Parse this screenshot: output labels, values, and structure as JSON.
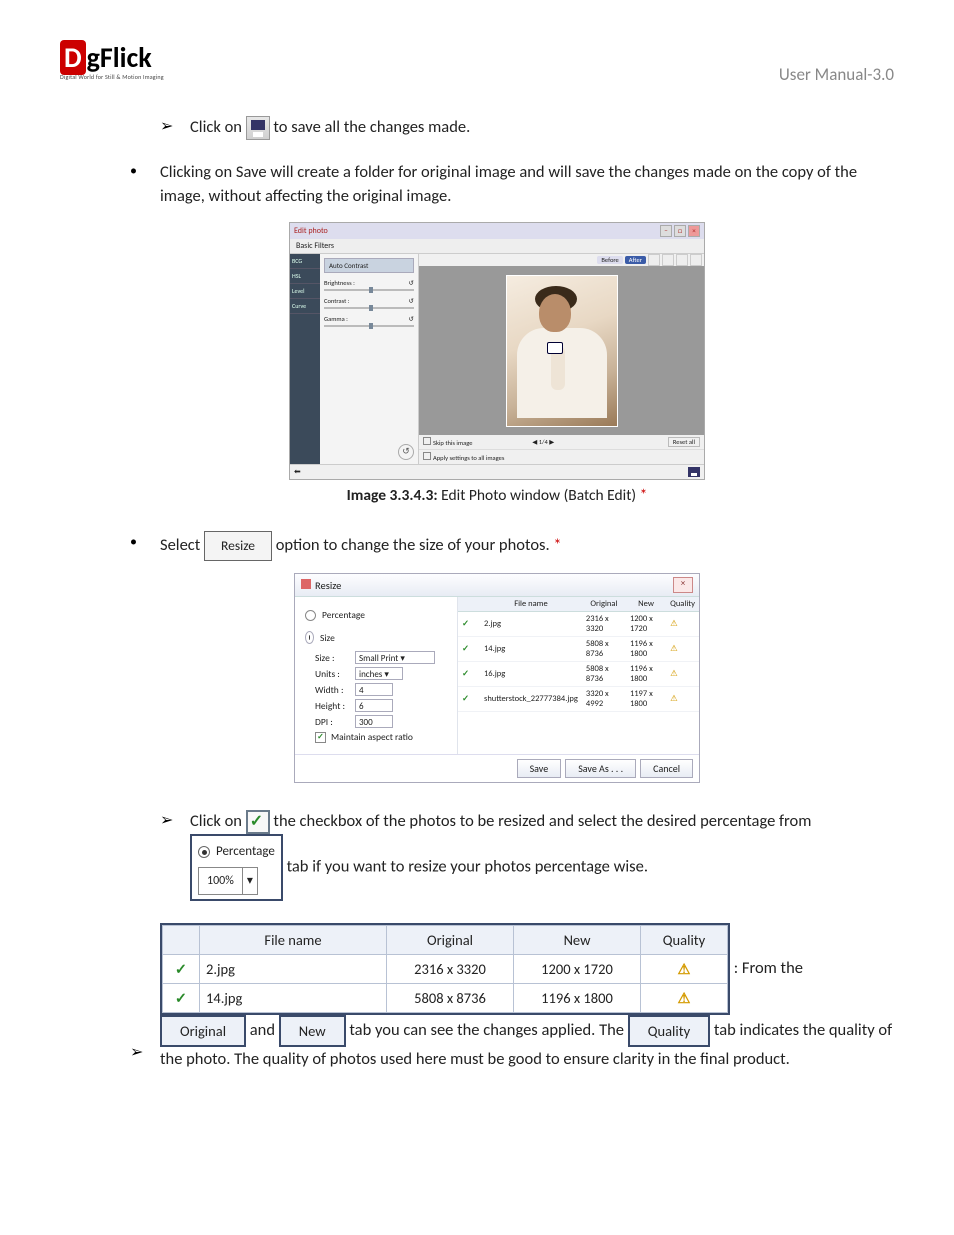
{
  "header": {
    "logo_main": "gFlick",
    "logo_sub": "Digital World for Still & Motion Imaging",
    "manual": "User Manual-3.0"
  },
  "body": {
    "p1a": "Click on ",
    "p1b": " to save all the changes made.",
    "p2": "Clicking on Save will create a folder for original image and will save the changes made on the copy of the image, without affecting the original image.",
    "caption1_bold": "Image 3.3.4.3:",
    "caption1_rest": " Edit Photo window (Batch Edit) ",
    "p3a": "Select ",
    "p3b": " option to change the size of your photos. ",
    "resize_label": "Resize",
    "p4a": "Click on ",
    "p4b": " the checkbox of the photos to be resized and select the desired percentage from ",
    "p4c": " tab if you want to resize your photos percentage wise.",
    "p5a": ": From the ",
    "p5b": " and ",
    "p5c": " tab you can see the changes applied. The ",
    "p5d": " tab indicates the quality of the photo. The quality of photos used here must be good to ensure clarity in the final product."
  },
  "editWin": {
    "title": "Edit photo",
    "tab": "Basic Filters",
    "side": [
      "BCG",
      "HSL",
      "Level",
      "Curve"
    ],
    "accordion": "Auto Contrast",
    "sliders": [
      "Brightness :",
      "Contrast :",
      "Gamma :"
    ],
    "sliderReset": "↺",
    "before": "Before",
    "after": "After",
    "skip": "Skip this image",
    "applyAll": "Apply settings to all images",
    "nav": "1/4",
    "resetAll": "Reset all"
  },
  "resizeDlg": {
    "title": "Resize",
    "percentage": "Percentage",
    "size": "Size",
    "fields": {
      "size": {
        "label": "Size :",
        "value": "Small Print"
      },
      "units": {
        "label": "Units :",
        "value": "inches"
      },
      "width": {
        "label": "Width :",
        "value": "4"
      },
      "height": {
        "label": "Height :",
        "value": "6"
      },
      "dpi": {
        "label": "DPI :",
        "value": "300"
      },
      "aspect": "Maintain aspect ratio"
    },
    "cols": [
      "",
      "File name",
      "Original",
      "New",
      "Quality"
    ],
    "rows": [
      {
        "file": "2.jpg",
        "orig": "2316 x 3320",
        "new": "1200 x 1720"
      },
      {
        "file": "14.jpg",
        "orig": "5808 x 8736",
        "new": "1196 x 1800"
      },
      {
        "file": "16.jpg",
        "orig": "5808 x 8736",
        "new": "1196 x 1800"
      },
      {
        "file": "shutterstock_22777384.jpg",
        "orig": "3320 x 4992",
        "new": "1197 x 1800"
      }
    ],
    "buttons": {
      "save": "Save",
      "saveAs": "Save As . . .",
      "cancel": "Cancel"
    }
  },
  "pctSnip": {
    "label": "Percentage",
    "value": "100%"
  },
  "tableSnip": {
    "cols": [
      "",
      "File name",
      "Original",
      "New",
      "Quality"
    ],
    "rows": [
      {
        "file": "2.jpg",
        "orig": "2316 x 3320",
        "new": "1200 x 1720"
      },
      {
        "file": "14.jpg",
        "orig": "5808 x 8736",
        "new": "1196 x 1800"
      }
    ]
  },
  "colSnips": {
    "original": "Original",
    "new": "New",
    "quality": "Quality"
  }
}
